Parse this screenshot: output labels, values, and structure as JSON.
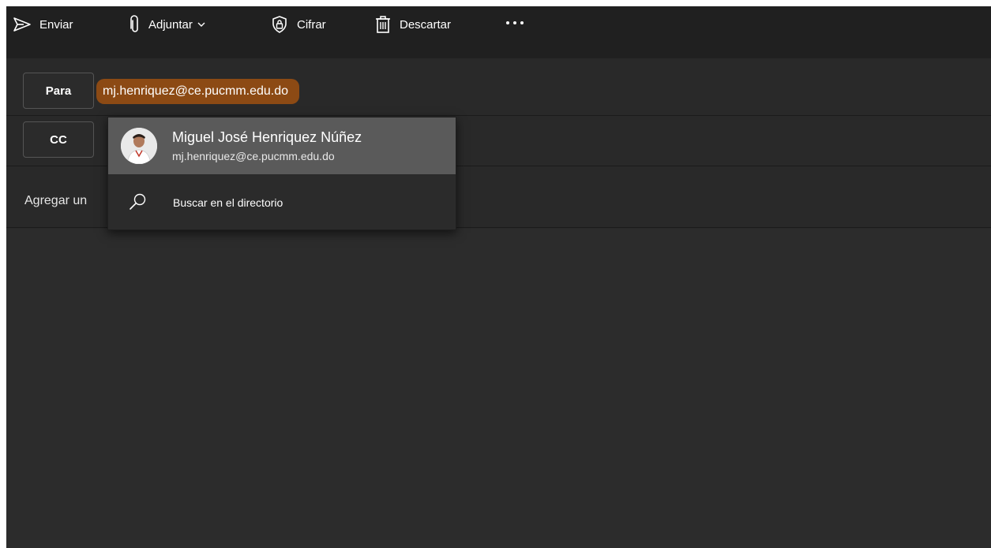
{
  "toolbar": {
    "send_label": "Enviar",
    "attach_label": "Adjuntar",
    "encrypt_label": "Cifrar",
    "discard_label": "Descartar",
    "more_label": "···"
  },
  "compose": {
    "to_label": "Para",
    "to_recipient": "mj.henriquez@ce.pucmm.edu.do",
    "cc_label": "CC",
    "subject_placeholder": "Agregar un"
  },
  "suggestions": {
    "contact_name": "Miguel José Henriquez Núñez",
    "contact_email": "mj.henriquez@ce.pucmm.edu.do",
    "search_directory_label": "Buscar en el directorio"
  },
  "colors": {
    "window_bg": "#292929",
    "toolbar_bg": "#202020",
    "chip_bg": "#8c4a14",
    "highlight_bg": "#5a5a5a"
  }
}
